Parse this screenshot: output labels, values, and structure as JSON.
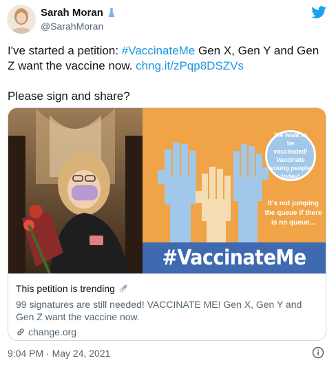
{
  "author": {
    "name": "Sarah Moran",
    "handle": "@SarahMoran",
    "name_emoji": "dress-icon"
  },
  "tweet": {
    "text_lead": "I've started a petition: ",
    "hashtag": "#VaccinateMe",
    "text_mid": " Gen X, Gen Y and Gen Z want the vaccine now. ",
    "link": "chng.it/zPqp8DSZVs",
    "text_second": "Please sign and share?"
  },
  "card": {
    "poster_bubble": "We want to be vaccinated! Vaccinate young people today!",
    "poster_queue": "It's not jumping the queue if there is no queue...",
    "poster_hashtag": "#VaccinateMe",
    "title": "This petition is trending",
    "title_emoji": "rocket-icon",
    "description": "99 signatures are still needed! VACCINATE ME! Gen X, Gen Y and Gen Z want the vaccine now.",
    "domain": "change.org"
  },
  "footer": {
    "timestamp": "9:04 PM · May 24, 2021"
  },
  "colors": {
    "link": "#1b95e0",
    "poster_orange": "#f0a347",
    "poster_blue": "#3f69b0",
    "twitter_blue": "#1da1f2"
  }
}
